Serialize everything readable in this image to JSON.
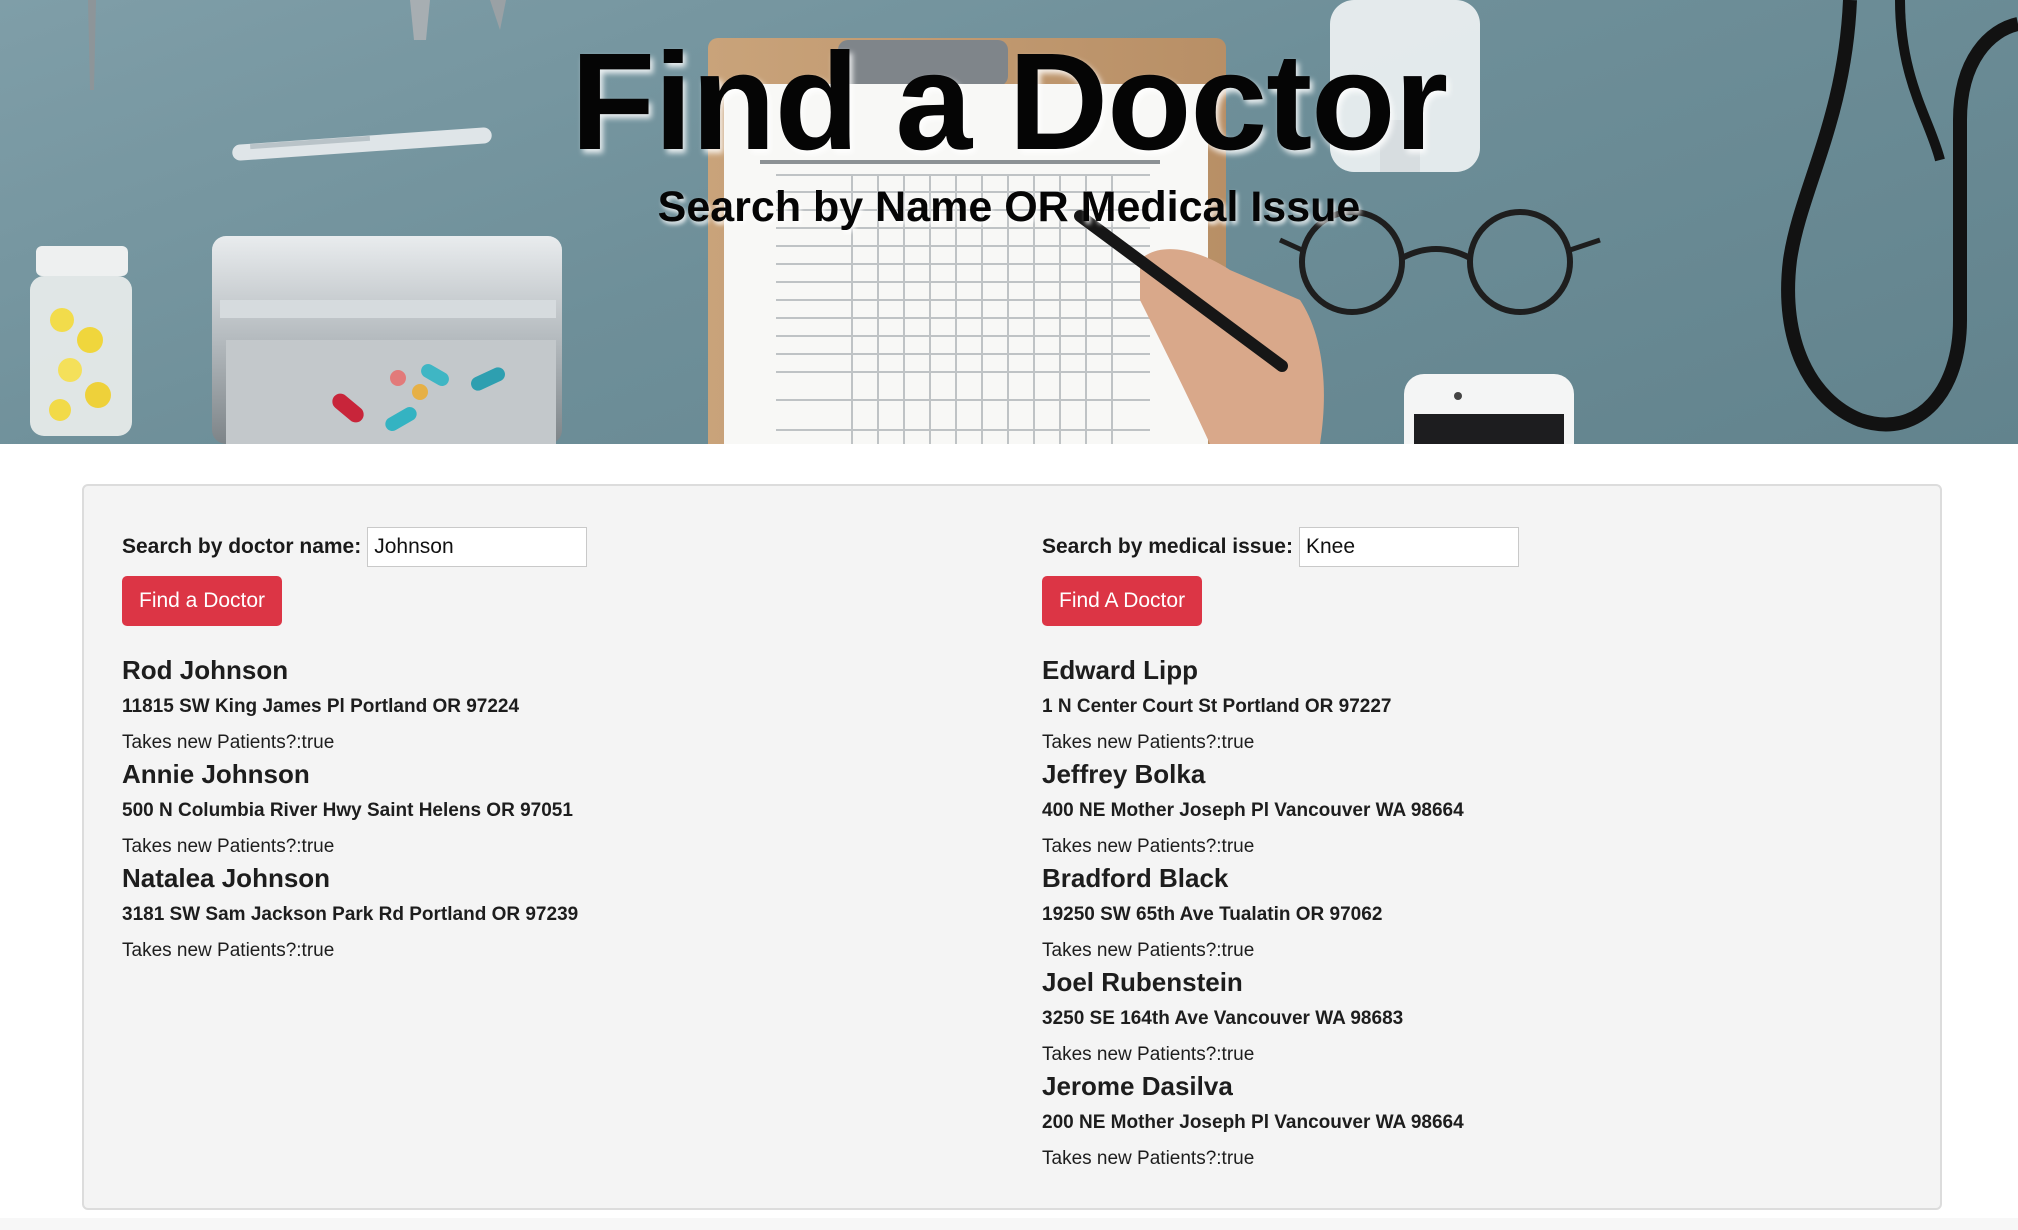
{
  "hero": {
    "title": "Find a Doctor",
    "subtitle": "Search by Name OR Medical Issue",
    "background_color": "#6e8f99"
  },
  "name_search": {
    "label": "Search by doctor name:",
    "value": "Johnson",
    "button_label": "Find a Doctor",
    "results": [
      {
        "name": "Rod Johnson",
        "address": "11815 SW King James Pl Portland OR 97224",
        "status": "Takes new Patients?:true"
      },
      {
        "name": "Annie Johnson",
        "address": "500 N Columbia River Hwy Saint Helens OR 97051",
        "status": "Takes new Patients?:true"
      },
      {
        "name": "Natalea Johnson",
        "address": "3181 SW Sam Jackson Park Rd Portland OR 97239",
        "status": "Takes new Patients?:true"
      }
    ]
  },
  "issue_search": {
    "label": "Search by medical issue:",
    "value": "Knee",
    "button_label": "Find A Doctor",
    "results": [
      {
        "name": "Edward Lipp",
        "address": "1 N Center Court St Portland OR 97227",
        "status": "Takes new Patients?:true"
      },
      {
        "name": "Jeffrey Bolka",
        "address": "400 NE Mother Joseph Pl Vancouver WA 98664",
        "status": "Takes new Patients?:true"
      },
      {
        "name": "Bradford Black",
        "address": "19250 SW 65th Ave Tualatin OR 97062",
        "status": "Takes new Patients?:true"
      },
      {
        "name": "Joel Rubenstein",
        "address": "3250 SE 164th Ave Vancouver WA 98683",
        "status": "Takes new Patients?:true"
      },
      {
        "name": "Jerome Dasilva",
        "address": "200 NE Mother Joseph Pl Vancouver WA 98664",
        "status": "Takes new Patients?:true"
      }
    ]
  },
  "colors": {
    "accent_button": "#dc3545",
    "panel_background": "#f4f4f4"
  }
}
